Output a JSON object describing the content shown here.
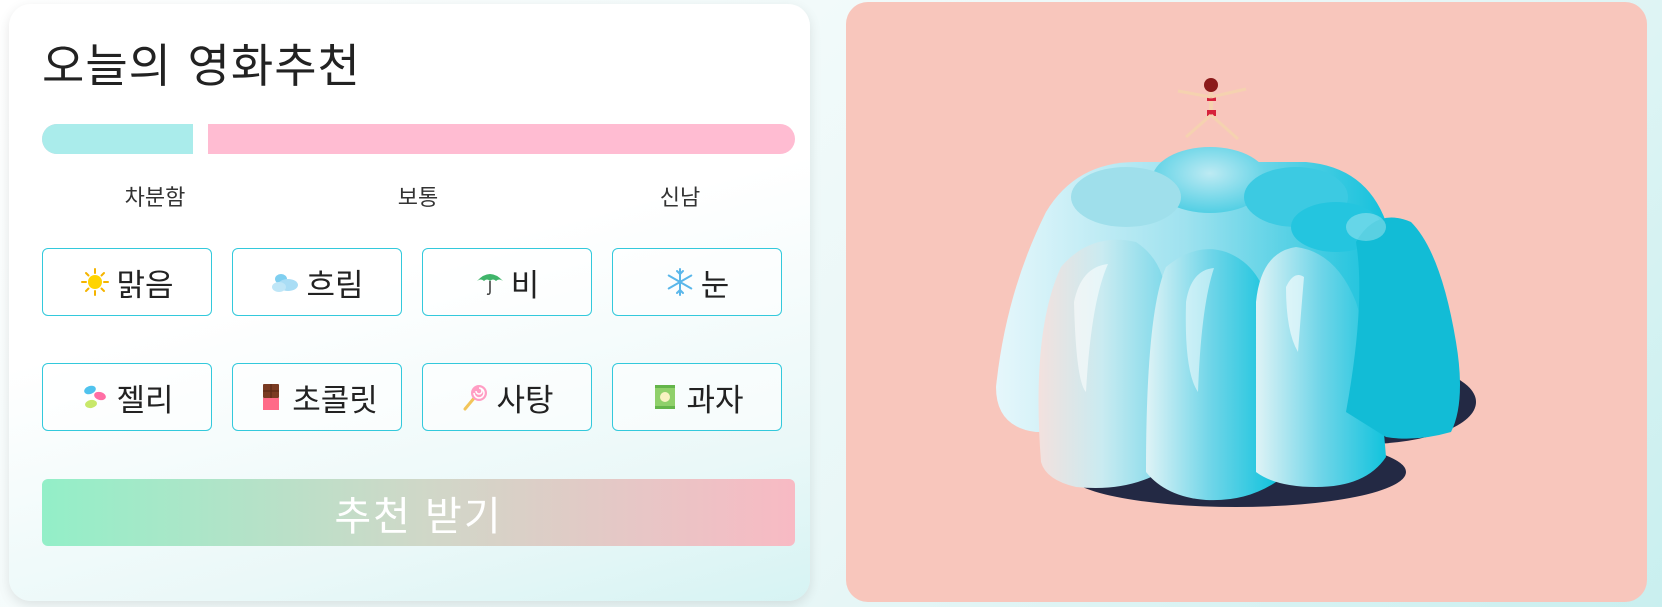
{
  "app": {
    "title": "오늘의 영화추천"
  },
  "mood": {
    "value_percent": 20,
    "labels": [
      "차분함",
      "보통",
      "신남"
    ]
  },
  "weather": [
    {
      "label": "맑음",
      "icon": "sun-icon"
    },
    {
      "label": "흐림",
      "icon": "cloud-icon"
    },
    {
      "label": "비",
      "icon": "umbrella-icon"
    },
    {
      "label": "눈",
      "icon": "snowflake-icon"
    }
  ],
  "snacks": [
    {
      "label": "젤리",
      "icon": "jelly-beans-icon"
    },
    {
      "label": "초콜릿",
      "icon": "chocolate-icon"
    },
    {
      "label": "사탕",
      "icon": "lollipop-icon"
    },
    {
      "label": "과자",
      "icon": "snack-bag-icon"
    }
  ],
  "submit": {
    "label": "추천 받기"
  },
  "colors": {
    "accent_border": "#33c9dc",
    "bar_calm": "#aaeceb",
    "bar_rest": "#ffbcd2",
    "illustration_bg": "#f8c6bc",
    "jelly": "#4fcfe4"
  }
}
